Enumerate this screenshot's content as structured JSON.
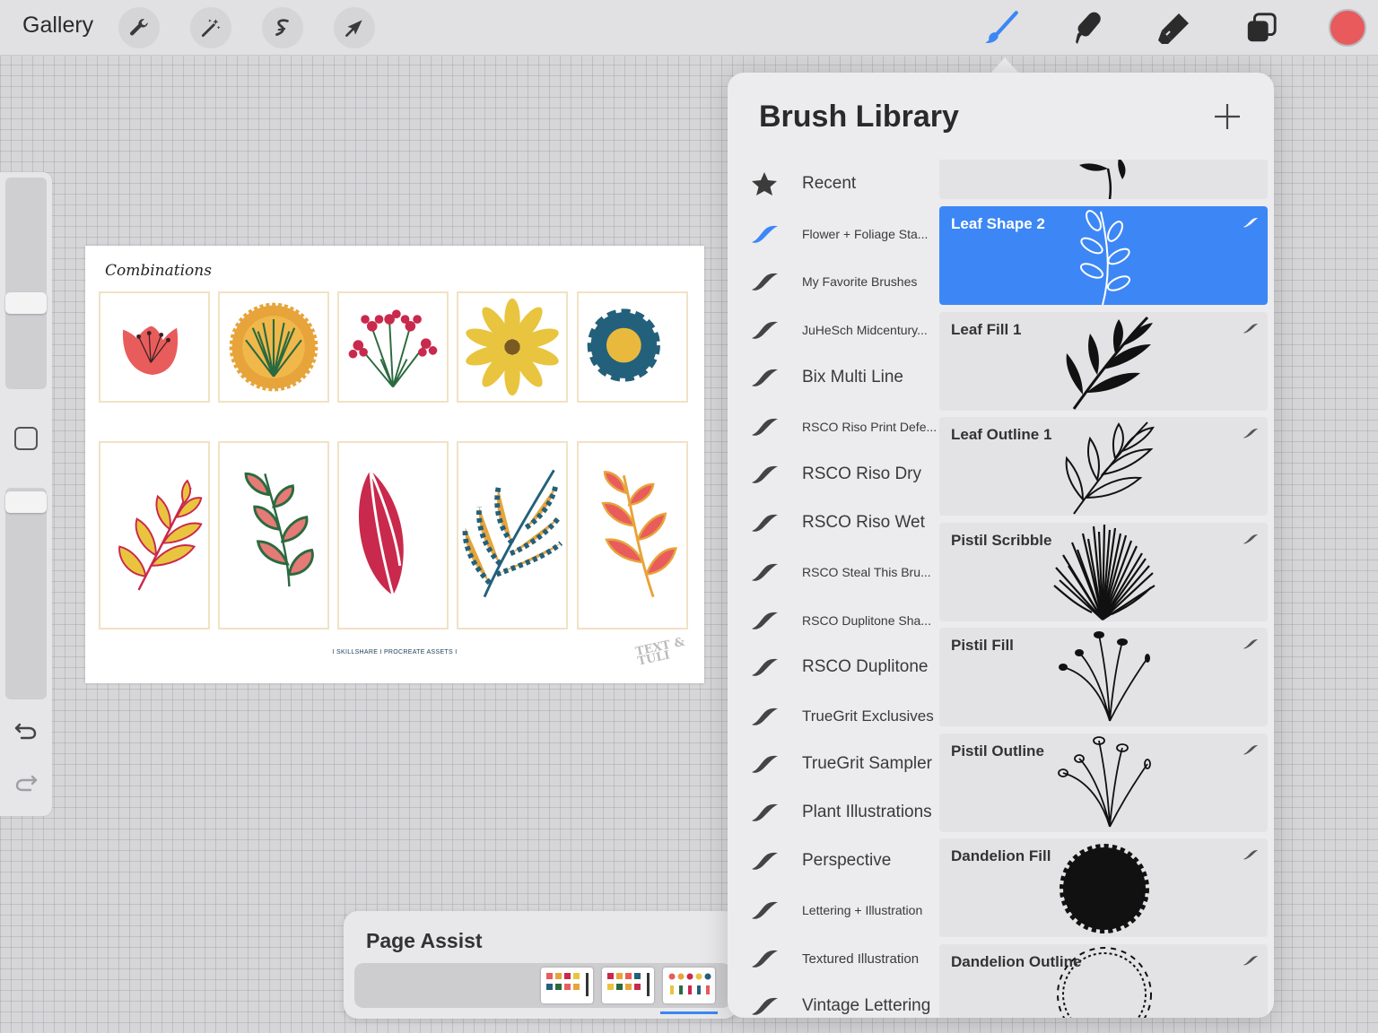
{
  "toolbar": {
    "gallery_label": "Gallery",
    "color": "#e85a5c"
  },
  "canvas": {
    "title": "Combinations",
    "footer": "I SKILLSHARE I PROCREATE ASSETS I",
    "logo": "TEXT & TULI"
  },
  "page_assist": {
    "title": "Page Assist"
  },
  "brush_library": {
    "title": "Brush Library",
    "sets": [
      {
        "label": "Recent",
        "size": "lg",
        "icon": "star-icon"
      },
      {
        "label": "Flower + Foliage Sta...",
        "size": "sm",
        "icon": "brush-stroke-icon",
        "active": true
      },
      {
        "label": "My Favorite Brushes",
        "size": "sm",
        "icon": "brush-stroke-icon"
      },
      {
        "label": "JuHeSch Midcentury...",
        "size": "sm",
        "icon": "brush-stroke-icon"
      },
      {
        "label": "Bix Multi Line",
        "size": "lg",
        "icon": "brush-stroke-icon"
      },
      {
        "label": "RSCO Riso Print Defe...",
        "size": "sm",
        "icon": "brush-stroke-icon"
      },
      {
        "label": "RSCO Riso Dry",
        "size": "lg",
        "icon": "brush-stroke-icon"
      },
      {
        "label": "RSCO Riso Wet",
        "size": "lg",
        "icon": "brush-stroke-icon"
      },
      {
        "label": "RSCO Steal This Bru...",
        "size": "sm",
        "icon": "brush-stroke-icon"
      },
      {
        "label": "RSCO Duplitone Sha...",
        "size": "sm",
        "icon": "brush-stroke-icon"
      },
      {
        "label": "RSCO Duplitone",
        "size": "lg",
        "icon": "brush-stroke-icon"
      },
      {
        "label": "TrueGrit Exclusives",
        "size": "lg",
        "icon": "brush-stroke-icon"
      },
      {
        "label": "TrueGrit Sampler",
        "size": "lg",
        "icon": "brush-stroke-icon"
      },
      {
        "label": "Plant Illustrations",
        "size": "lg",
        "icon": "brush-stroke-icon"
      },
      {
        "label": "Perspective",
        "size": "lg",
        "icon": "brush-stroke-icon"
      },
      {
        "label": "Lettering + Illustration",
        "size": "sm",
        "icon": "brush-stroke-icon"
      },
      {
        "label": "Textured Illustration",
        "size": "sm",
        "icon": "brush-stroke-icon"
      },
      {
        "label": "Vintage Lettering",
        "size": "lg",
        "icon": "brush-stroke-icon"
      }
    ],
    "brushes": [
      {
        "name": "",
        "preview": "leaf-shape-top"
      },
      {
        "name": "Leaf Shape 2",
        "preview": "leaf-outline-sprig",
        "selected": true
      },
      {
        "name": "Leaf Fill 1",
        "preview": "leaf-fill"
      },
      {
        "name": "Leaf Outline 1",
        "preview": "leaf-outline"
      },
      {
        "name": "Pistil Scribble",
        "preview": "pistil-scribble"
      },
      {
        "name": "Pistil Fill",
        "preview": "pistil-fill"
      },
      {
        "name": "Pistil Outline",
        "preview": "pistil-outline"
      },
      {
        "name": "Dandelion Fill",
        "preview": "dandelion-fill"
      },
      {
        "name": "Dandelion Outline",
        "preview": "dandelion-outline"
      }
    ]
  }
}
